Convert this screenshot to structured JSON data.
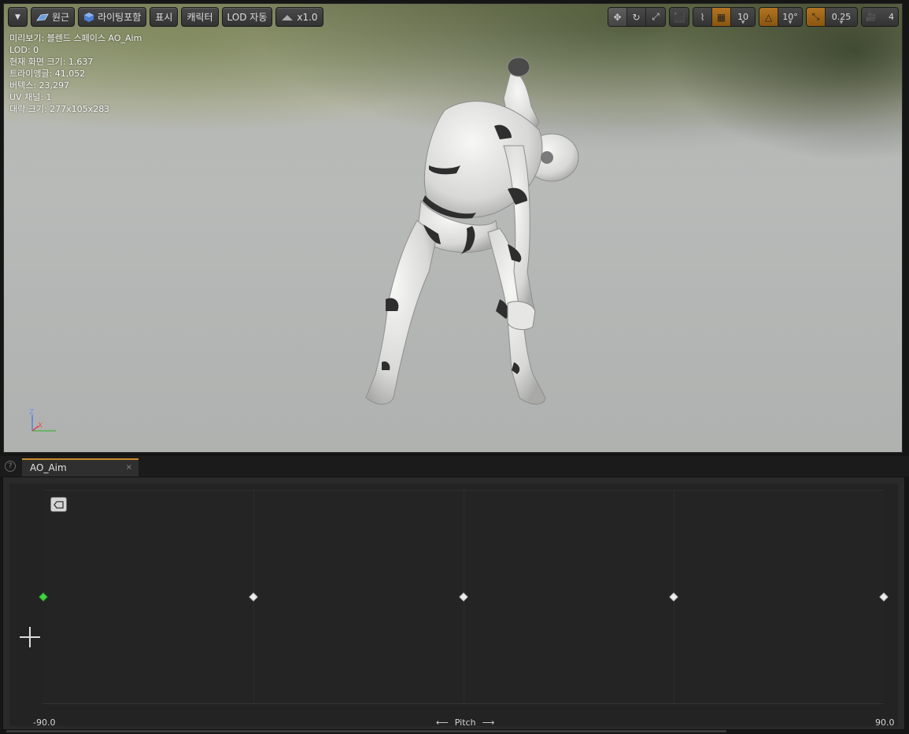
{
  "viewport": {
    "toolbar_left": {
      "perspective_label": "원근",
      "lighting_label": "라이팅포함",
      "show_label": "표시",
      "character_label": "캐릭터",
      "lod_label": "LOD 자동",
      "speed_label": "x1.0"
    },
    "toolbar_right": {
      "grid_snap_value": "10",
      "rotation_snap_value": "10°",
      "scale_snap_value": "0.25",
      "camera_speed_value": "4"
    },
    "stats": [
      "미리보기: 블렌드 스페이스 AO_Aim",
      "LOD: 0",
      "현재 화면 크기: 1.637",
      "트라이앵글: 41,052",
      "버텍스: 23,297",
      "UV 채널: 1",
      "대략 크기: 277x105x283"
    ],
    "axis": {
      "z": "Z",
      "x": "X"
    }
  },
  "editor": {
    "tab_label": "AO_Aim",
    "tab_close": "×",
    "help": "?",
    "x_axis": {
      "min_label": "-90.0",
      "max_label": "90.0",
      "parameter_label": "Pitch",
      "left_arrow": "⟵",
      "right_arrow": "⟶"
    },
    "samples": [
      {
        "value": -90,
        "active": true
      },
      {
        "value": -45,
        "active": false
      },
      {
        "value": 0,
        "active": false
      },
      {
        "value": 45,
        "active": false
      },
      {
        "value": 90,
        "active": false
      }
    ],
    "colors": {
      "active_sample": "#3fd63f",
      "tab_accent": "#c88a2a"
    }
  }
}
